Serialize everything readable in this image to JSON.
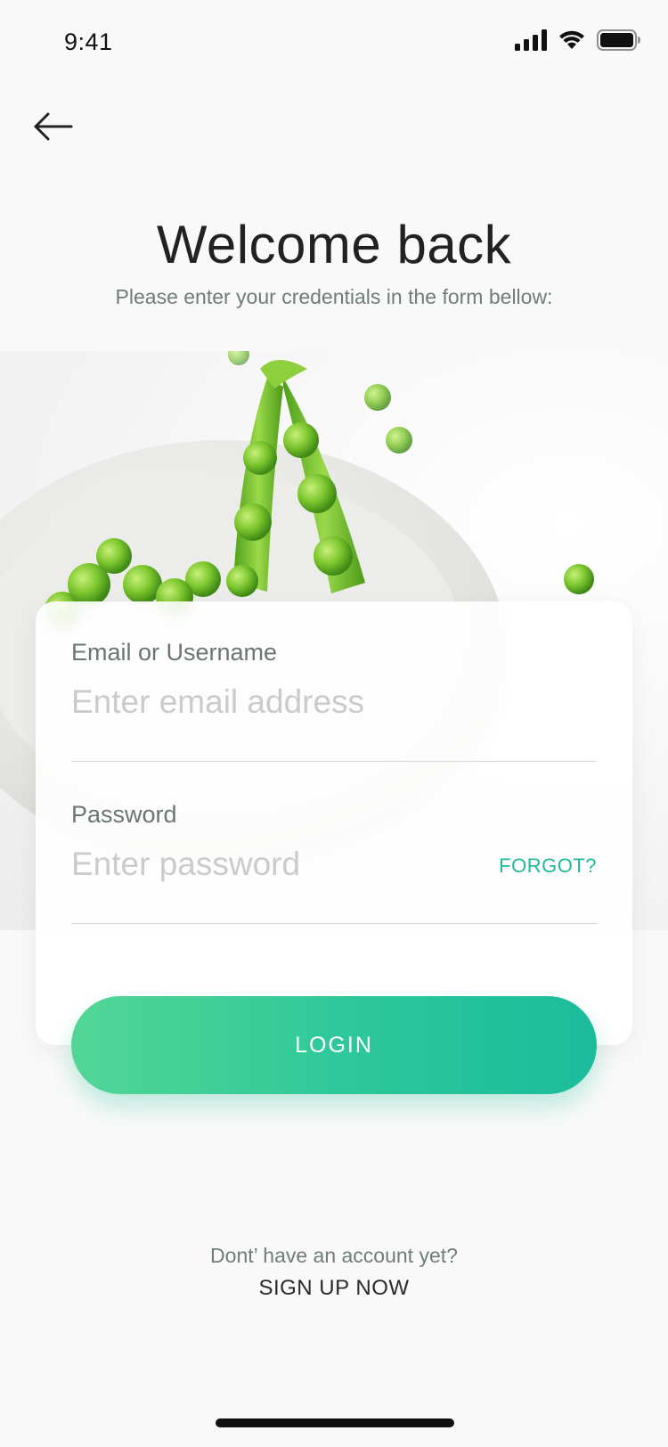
{
  "status_bar": {
    "time": "9:41",
    "icons": [
      "signal-icon",
      "wifi-icon",
      "battery-icon"
    ]
  },
  "header": {
    "back_icon": "arrow-left-icon",
    "title": "Welcome back",
    "subtitle": "Please enter your credentials in the form bellow:"
  },
  "form": {
    "email": {
      "label": "Email or Username",
      "placeholder": "Enter email address",
      "value": ""
    },
    "password": {
      "label": "Password",
      "placeholder": "Enter password",
      "value": "",
      "forgot_label": "FORGOT?"
    },
    "login_label": "LOGIN"
  },
  "footer": {
    "prompt": "Dont’ have an account yet?",
    "signup_label": "SIGN UP NOW"
  },
  "colors": {
    "accent": "#1fb89a",
    "button_gradient_start": "#53d695",
    "button_gradient_end": "#1bbc9c",
    "background": "#f9f9f9"
  }
}
